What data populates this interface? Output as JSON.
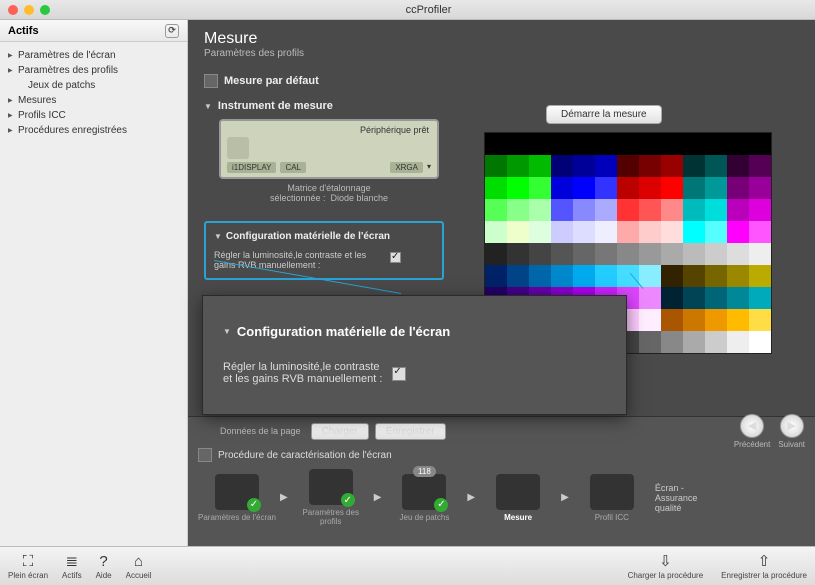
{
  "title": "ccProfiler",
  "sidebar": {
    "header": "Actifs",
    "items": [
      "Paramètres de l'écran",
      "Paramètres des profils",
      "Jeux de patchs",
      "Mesures",
      "Profils ICC",
      "Procédures enregistrées"
    ]
  },
  "page": {
    "title": "Mesure",
    "subtitle": "Paramètres des profils",
    "default_section": "Mesure par défaut",
    "instrument_section": "Instrument de mesure",
    "instrument_status": "Périphérique prêt",
    "instr_btn1": "i1DISPLAY",
    "instr_btn2": "CAL",
    "instr_btn3": "XRGA",
    "instr_caption1": "Matrice d'étalonnage",
    "instr_caption2": "sélectionnée :",
    "instr_caption3": "Diode blanche",
    "config_title": "Configuration matérielle de l'écran",
    "config_option": "Régler la luminosité,le contraste et les gains RVB manuellement :",
    "measure_btn": "Démarre la mesure"
  },
  "zoom": {
    "title": "Configuration matérielle de l'écran",
    "line1": "Régler la luminosité,le contraste",
    "line2": "et les gains RVB manuellement :"
  },
  "workflow": {
    "page_data_label": "Données de la page",
    "load": "Charger",
    "save": "Enregistrer",
    "prev": "Précédent",
    "next": "Suivant",
    "proc_title": "Procédure de caractérisation de l'écran",
    "steps": [
      "Paramètres de l'écran",
      "Paramètres des profils",
      "Jeu de patchs",
      "Mesure",
      "Profil ICC"
    ],
    "extra": "Écran - Assurance qualité",
    "badge": "118"
  },
  "footer": {
    "fullscreen": "Plein écran",
    "assets": "Actifs",
    "help": "Aide",
    "home": "Accueil",
    "load_proc": "Charger la procédure",
    "save_proc": "Enregistrer la procédure"
  },
  "colors_grid": [
    [
      "#000",
      "#000",
      "#000",
      "#000",
      "#000",
      "#000",
      "#000",
      "#000",
      "#000",
      "#000",
      "#000",
      "#000",
      "#000"
    ],
    [
      "#070",
      "#090",
      "#0b0",
      "#007",
      "#009",
      "#00b",
      "#500",
      "#700",
      "#900",
      "#033",
      "#055",
      "#303",
      "#505"
    ],
    [
      "#0d0",
      "#0f0",
      "#3f3",
      "#00d",
      "#00f",
      "#33f",
      "#b00",
      "#d00",
      "#f00",
      "#077",
      "#099",
      "#707",
      "#909"
    ],
    [
      "#5f5",
      "#8f8",
      "#afa",
      "#55f",
      "#88f",
      "#aaf",
      "#f33",
      "#f55",
      "#f88",
      "#0bb",
      "#0dd",
      "#b0b",
      "#d0d"
    ],
    [
      "#cfc",
      "#efc",
      "#dfd",
      "#ccf",
      "#ddf",
      "#eef",
      "#faa",
      "#fcc",
      "#fdd",
      "#0ff",
      "#5ff",
      "#f0f",
      "#f5f"
    ],
    [
      "#222",
      "#333",
      "#444",
      "#555",
      "#666",
      "#777",
      "#888",
      "#999",
      "#aaa",
      "#bbb",
      "#ccc",
      "#ddd",
      "#eee"
    ],
    [
      "#026",
      "#048",
      "#06a",
      "#08c",
      "#0ae",
      "#2cf",
      "#4df",
      "#8ef",
      "#320",
      "#540",
      "#760",
      "#980",
      "#ba0"
    ],
    [
      "#206",
      "#408",
      "#60a",
      "#80c",
      "#a0e",
      "#c2f",
      "#d4f",
      "#e8f",
      "#023",
      "#045",
      "#067",
      "#089",
      "#0ab"
    ],
    [
      "#f0a",
      "#f2b",
      "#f4c",
      "#f6d",
      "#f8e",
      "#fae",
      "#fcf",
      "#fef",
      "#a50",
      "#c70",
      "#e90",
      "#fb0",
      "#fd4"
    ],
    [
      "#f05",
      "#f27",
      "#f49",
      "#f6b",
      "#f8d",
      "#222",
      "#444",
      "#666",
      "#888",
      "#aaa",
      "#ccc",
      "#eee",
      "#fff"
    ]
  ]
}
